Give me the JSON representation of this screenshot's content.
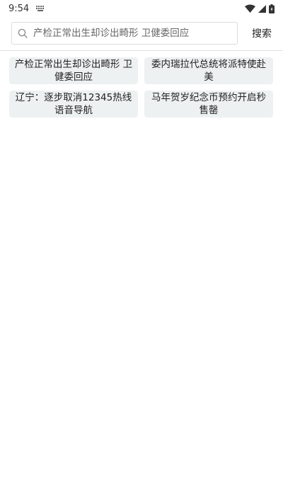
{
  "status_bar": {
    "time": "9:54",
    "icons": [
      "keyboard-icon",
      "wifi-icon",
      "cell-signal-icon",
      "battery-icon"
    ]
  },
  "search": {
    "placeholder": "产检正常出生却诊出畸形 卫健委回应",
    "button_label": "搜索"
  },
  "suggestions": [
    "产检正常出生却诊出畸形 卫健委回应",
    "委内瑞拉代总统将派特使赴美",
    "辽宁：逐步取消12345热线语音导航",
    "马年贺岁纪念币预约开启秒售罄"
  ],
  "colors": {
    "chip_background": "#eef1f2",
    "border": "#dcdcdc"
  }
}
